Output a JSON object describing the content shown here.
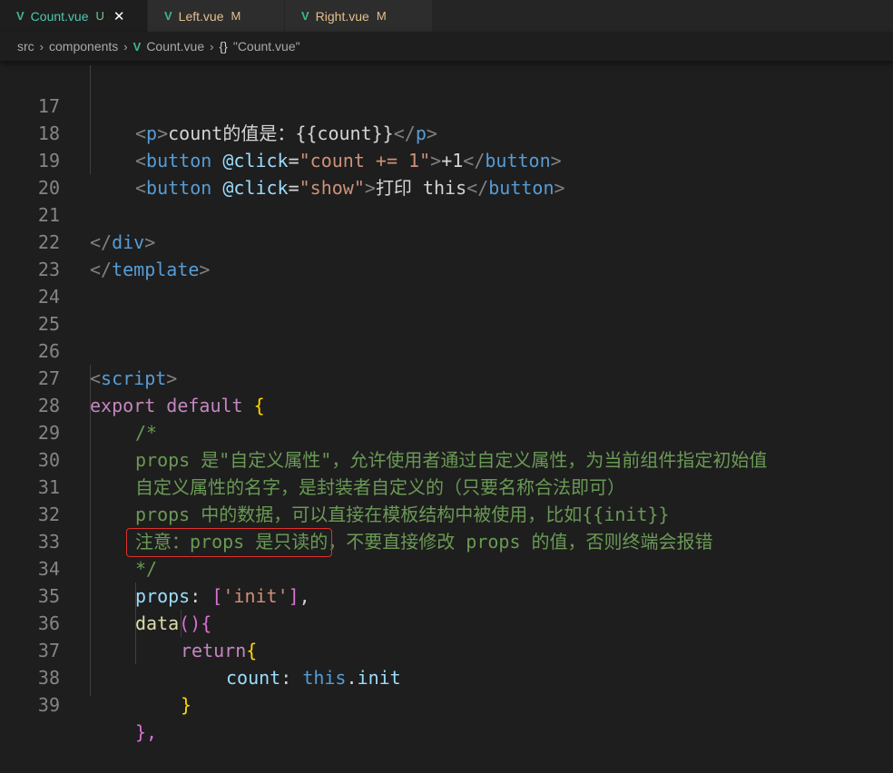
{
  "tabs": [
    {
      "name": "Count.vue",
      "status": "U",
      "close": "✕"
    },
    {
      "name": "Left.vue",
      "status": "M"
    },
    {
      "name": "Right.vue",
      "status": "M"
    }
  ],
  "breadcrumb": {
    "part1": "src",
    "part2": "components",
    "part3": "Count.vue",
    "braces": "{}",
    "part4": "\"Count.vue\""
  },
  "line_numbers": [
    "17",
    "18",
    "19",
    "20",
    "21",
    "22",
    "23",
    "24",
    "25",
    "26",
    "27",
    "28",
    "29",
    "30",
    "31",
    "32",
    "33",
    "34",
    "35",
    "36",
    "37",
    "38",
    "39"
  ],
  "code": {
    "l17": {
      "open_tag": "p",
      "text": "count的值是：{{count}}",
      "close_tag": "p"
    },
    "l18": {
      "tag": "button",
      "attr": "@click",
      "value": "\"count += 1\"",
      "text": "+1",
      "close_tag": "button"
    },
    "l19": {
      "tag": "button",
      "attr": "@click",
      "value": "\"show\"",
      "text": "打印 this",
      "close_tag": "button"
    },
    "l21": {
      "close_tag": "div"
    },
    "l22": {
      "close_tag": "template"
    },
    "l26": {
      "open_tag": "script"
    },
    "l27": {
      "kw1": "export",
      "kw2": "default",
      "brace": "{"
    },
    "l28": "/*",
    "l29": "props 是\"自定义属性\"，允许使用者通过自定义属性，为当前组件指定初始值",
    "l30": "自定义属性的名字，是封装者自定义的（只要名称合法即可）",
    "l31": "props 中的数据，可以直接在模板结构中被使用，比如{{init}}",
    "l32": "注意：props 是只读的，不要直接修改 props 的值，否则终端会报错",
    "l33": "*/",
    "l34": {
      "prop": "props",
      "colon": ": ",
      "value": "'init'"
    },
    "l35": {
      "fn": "data",
      "paren": "()",
      "brace": "{"
    },
    "l36": {
      "kw": "return",
      "brace": "{"
    },
    "l37": {
      "prop": "count",
      "colon": ": ",
      "this": "this",
      "member": "init"
    },
    "l38": {
      "brace": "}"
    },
    "l39": {
      "brace": "},"
    }
  },
  "colors": {
    "editor_bg": "#1e1e1e",
    "highlight_box": "#e0302a",
    "vue_green": "#41b883"
  }
}
